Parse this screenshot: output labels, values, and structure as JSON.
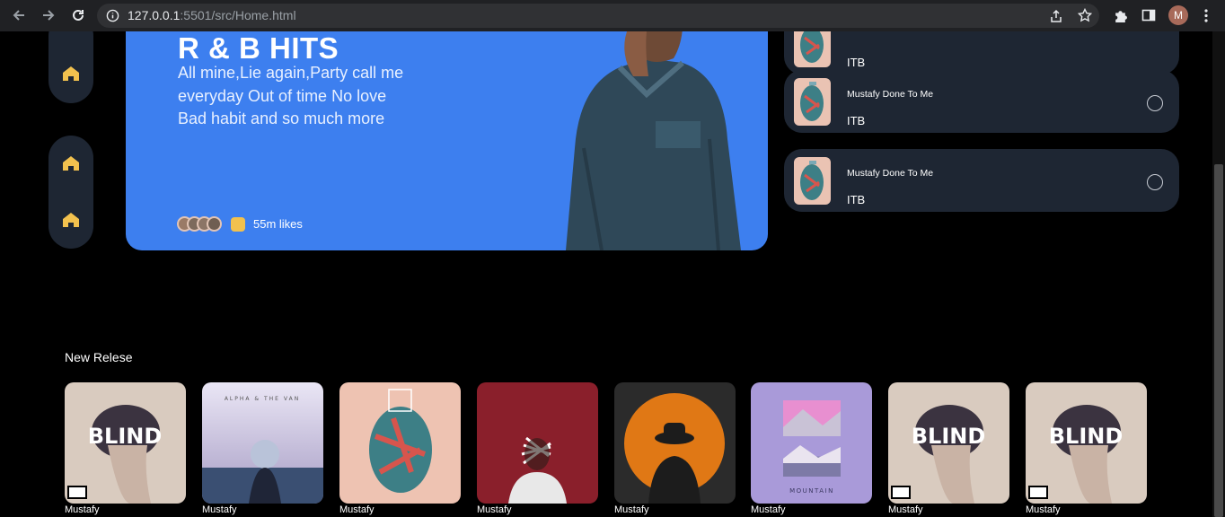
{
  "browser": {
    "url_host": "127.0.0.1",
    "url_rest": ":5501/src/Home.html",
    "profile_initial": "M"
  },
  "hero": {
    "title": "R & B HITS",
    "description": "All mine,Lie again,Party call me everyday Out of time No love Bad habit and so much more",
    "likes": "55m likes"
  },
  "songs": [
    {
      "title": "",
      "artist": "ITB"
    },
    {
      "title": "Mustafy Done To Me",
      "artist": "ITB"
    },
    {
      "title": "Mustafy Done To Me",
      "artist": "ITB"
    }
  ],
  "new_release": {
    "title": "New Relese",
    "albums": [
      {
        "artist": "Mustafy",
        "cover": "BLIND"
      },
      {
        "artist": "Mustafy",
        "cover": "ALPHA & THE VAN"
      },
      {
        "artist": "Mustafy",
        "cover": ""
      },
      {
        "artist": "Mustafy",
        "cover": ""
      },
      {
        "artist": "Mustafy",
        "cover": ""
      },
      {
        "artist": "Mustafy",
        "cover": "MOUNTAIN"
      },
      {
        "artist": "Mustafy",
        "cover": "BLIND"
      },
      {
        "artist": "Mustafy",
        "cover": "BLIND"
      }
    ]
  },
  "colors": {
    "accent": "#3d7fef",
    "card": "#1e2633",
    "home_icon": "#f2c14e"
  }
}
